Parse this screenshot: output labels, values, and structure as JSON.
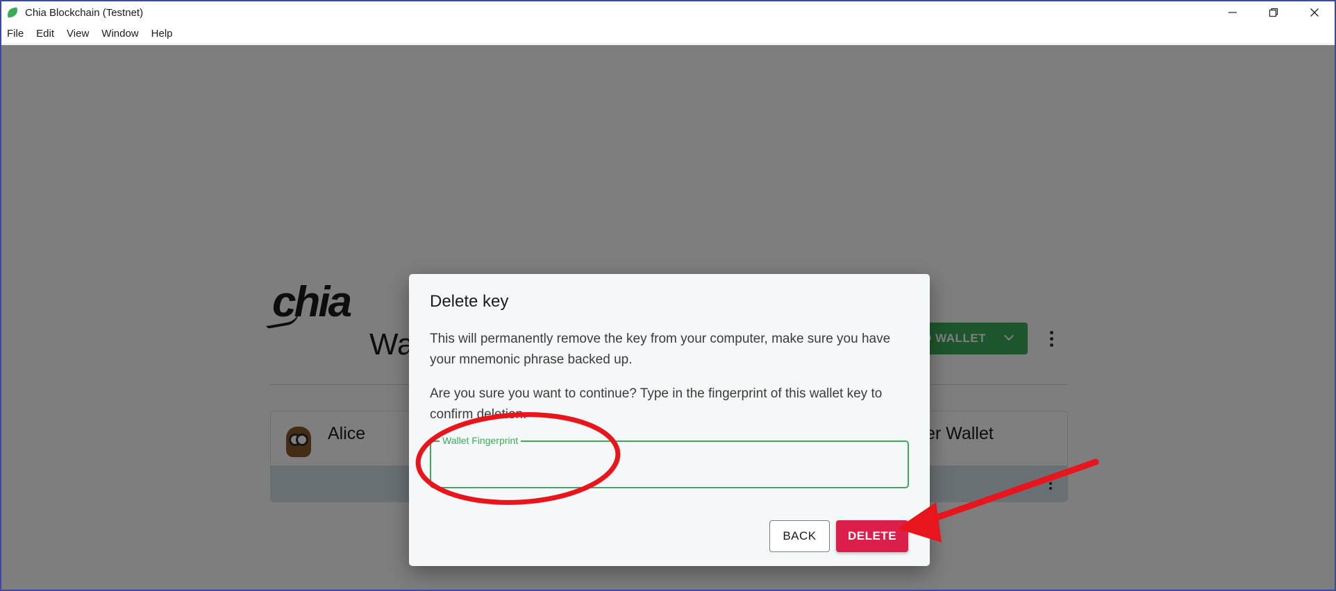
{
  "window": {
    "title": "Chia Blockchain (Testnet)",
    "minimize_icon": "minimize-icon",
    "restore_icon": "restore-icon",
    "close_icon": "close-icon"
  },
  "menu": [
    "File",
    "Edit",
    "View",
    "Window",
    "Help"
  ],
  "background": {
    "logo_text": "chia",
    "page_title": "Wa",
    "add_wallet_label": "DD WALLET",
    "wallet_cards": [
      {
        "name": "Alice"
      },
      {
        "name": "er Wallet"
      }
    ]
  },
  "dialog": {
    "title": "Delete key",
    "text1": "This will permanently remove the key from your computer, make sure you have your mnemonic phrase backed up.",
    "text2": "Are you sure you want to continue? Type in the fingerprint of this wallet key to confirm deletion.",
    "field_label": "Wallet Fingerprint",
    "field_value": "",
    "back_label": "BACK",
    "delete_label": "DELETE"
  },
  "colors": {
    "accent_green": "#3aac59",
    "delete_red": "#dc1f4a",
    "annotation_red": "#e8161c"
  }
}
